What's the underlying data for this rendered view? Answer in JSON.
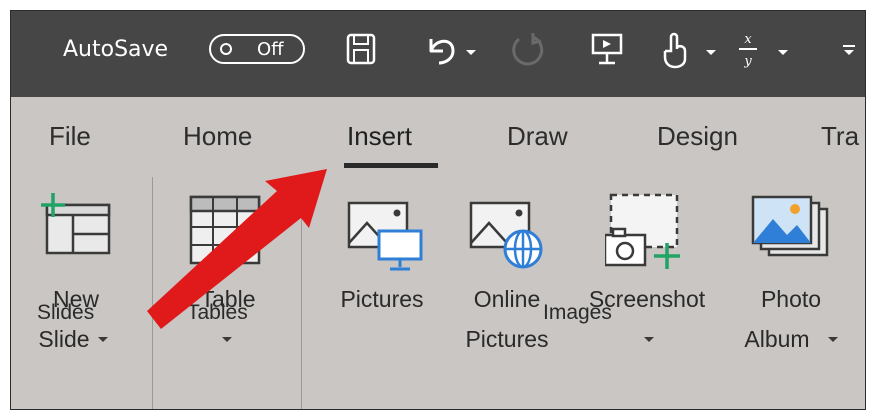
{
  "titlebar": {
    "autosave_label": "AutoSave",
    "autosave_state": "Off",
    "qat_icons": [
      "save-icon",
      "undo-icon",
      "redo-icon",
      "presentation-icon",
      "touch-mode-icon",
      "equation-icon",
      "customize-icon"
    ]
  },
  "ribbon": {
    "tabs": [
      {
        "label": "File"
      },
      {
        "label": "Home"
      },
      {
        "label": "Insert",
        "active": true
      },
      {
        "label": "Draw"
      },
      {
        "label": "Design"
      },
      {
        "label": "Tra"
      }
    ],
    "groups": {
      "slides": {
        "label": "Slides",
        "new_slide": {
          "line1": "New",
          "line2": "Slide"
        }
      },
      "tables": {
        "label": "Tables",
        "table": {
          "line1": "Table"
        }
      },
      "images": {
        "label": "Images",
        "pictures": {
          "line1": "Pictures"
        },
        "online_pictures": {
          "line1": "Online",
          "line2": "Pictures"
        },
        "screenshot": {
          "line1": "Screenshot"
        },
        "photo_album": {
          "line1": "Photo",
          "line2": "Album"
        }
      }
    }
  },
  "colors": {
    "titlebar_bg": "#464646",
    "ribbon_bg": "#c9c6c3",
    "accent_green": "#21a366",
    "accent_blue": "#2f7fd8",
    "annotation_arrow": "#e0191b"
  }
}
